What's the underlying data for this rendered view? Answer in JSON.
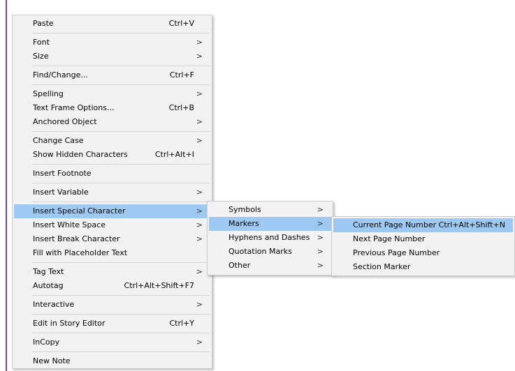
{
  "main_menu": {
    "groups": [
      [
        {
          "label": "Paste",
          "shortcut": "Ctrl+V",
          "arrow": false
        }
      ],
      [
        {
          "label": "Font",
          "shortcut": "",
          "arrow": true
        },
        {
          "label": "Size",
          "shortcut": "",
          "arrow": true
        }
      ],
      [
        {
          "label": "Find/Change...",
          "shortcut": "Ctrl+F",
          "arrow": false
        }
      ],
      [
        {
          "label": "Spelling",
          "shortcut": "",
          "arrow": true
        },
        {
          "label": "Text Frame Options...",
          "shortcut": "Ctrl+B",
          "arrow": false
        },
        {
          "label": "Anchored Object",
          "shortcut": "",
          "arrow": true
        }
      ],
      [
        {
          "label": "Change Case",
          "shortcut": "",
          "arrow": true
        },
        {
          "label": "Show Hidden Characters",
          "shortcut": "Ctrl+Alt+I",
          "arrow": false
        }
      ],
      [
        {
          "label": "Insert Footnote",
          "shortcut": "",
          "arrow": false
        }
      ],
      [
        {
          "label": "Insert Variable",
          "shortcut": "",
          "arrow": true
        }
      ],
      [
        {
          "label": "Insert Special Character",
          "shortcut": "",
          "arrow": true,
          "highlighted": true
        },
        {
          "label": "Insert White Space",
          "shortcut": "",
          "arrow": true
        },
        {
          "label": "Insert Break Character",
          "shortcut": "",
          "arrow": true
        },
        {
          "label": "Fill with Placeholder Text",
          "shortcut": "",
          "arrow": false
        }
      ],
      [
        {
          "label": "Tag Text",
          "shortcut": "",
          "arrow": true
        },
        {
          "label": "Autotag",
          "shortcut": "Ctrl+Alt+Shift+F7",
          "arrow": false
        }
      ],
      [
        {
          "label": "Interactive",
          "shortcut": "",
          "arrow": true
        }
      ],
      [
        {
          "label": "Edit in Story Editor",
          "shortcut": "Ctrl+Y",
          "arrow": false
        }
      ],
      [
        {
          "label": "InCopy",
          "shortcut": "",
          "arrow": true
        }
      ],
      [
        {
          "label": "New Note",
          "shortcut": "",
          "arrow": false
        }
      ]
    ]
  },
  "special_character_menu": {
    "items": [
      {
        "label": "Symbols",
        "arrow": true
      },
      {
        "label": "Markers",
        "arrow": true,
        "highlighted": true
      },
      {
        "label": "Hyphens and Dashes",
        "arrow": true
      },
      {
        "label": "Quotation Marks",
        "arrow": true
      },
      {
        "label": "Other",
        "arrow": true
      }
    ]
  },
  "markers_menu": {
    "items": [
      {
        "label": "Current Page Number",
        "shortcut": "Ctrl+Alt+Shift+N",
        "highlighted": true
      },
      {
        "label": "Next Page Number",
        "shortcut": ""
      },
      {
        "label": "Previous Page Number",
        "shortcut": ""
      },
      {
        "label": "Section Marker",
        "shortcut": ""
      }
    ]
  },
  "submenu_arrow_glyph": ">",
  "colors": {
    "menu_background": "#f2f2f2",
    "highlight": "#9ec9f2",
    "separator": "#d4d4d4"
  }
}
